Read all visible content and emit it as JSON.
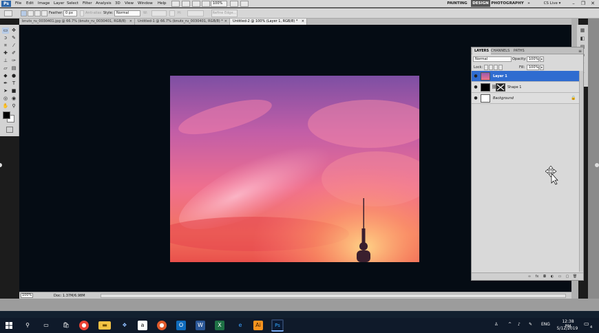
{
  "app": {
    "logo": "Ps"
  },
  "menu": [
    "File",
    "Edit",
    "Image",
    "Layer",
    "Select",
    "Filter",
    "Analysis",
    "3D",
    "View",
    "Window",
    "Help"
  ],
  "top_toolbar": {
    "zoom": "100%"
  },
  "workspaces": {
    "painting": "PAINTING",
    "design": "DESIGN",
    "photography": "PHOTOGRAPHY",
    "more": "»",
    "cs_live": "CS Live ▾"
  },
  "window_controls": {
    "minimize": "–",
    "restore": "❐",
    "close": "✕"
  },
  "options": {
    "feather_label": "Feather:",
    "feather_value": "0 px",
    "antialias_label": "Anti-alias",
    "style_label": "Style:",
    "style_value": "Normal",
    "width_label": "W:",
    "height_label": "H:",
    "refine_edge": "Refine Edge..."
  },
  "doc_tabs": [
    "bnuts_ru_0030401.jpg @ 66.7% (bnuts_ru_0030401, RGB/8)",
    "Untitled-1 @ 66.7% (bnuts_ru_0030401, RGB/8) *",
    "Untitled-2 @ 100% (Layer 1, RGB/8) *"
  ],
  "doc_tab_close": "×",
  "layers_panel": {
    "tabs": [
      "LAYERS",
      "CHANNELS",
      "PATHS"
    ],
    "blend_mode": "Normal",
    "opacity_label": "Opacity:",
    "opacity_value": "100%",
    "lock_label": "Lock:",
    "fill_label": "Fill:",
    "fill_value": "100%",
    "layers": [
      "Layer 1",
      "Shape 1",
      "Background"
    ]
  },
  "status": {
    "zoom": "100%",
    "doc": "Doc: 1.37M/6.98M"
  },
  "clock": {
    "time": "12:38 PM",
    "date": "5/12/2019"
  },
  "tray": {
    "language": "ENG",
    "notification_count": "4"
  },
  "colors": {
    "accent": "#2f6cd0",
    "canvas_bg": "#050c14",
    "ui_bg": "#d6d6d6"
  }
}
